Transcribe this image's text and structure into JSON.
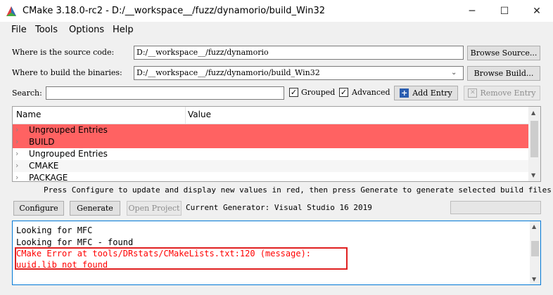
{
  "window": {
    "title": "CMake 3.18.0-rc2 - D:/__workspace__/fuzz/dynamorio/build_Win32",
    "minimize_glyph": "─",
    "maximize_glyph": "☐",
    "close_glyph": "✕"
  },
  "menu": [
    {
      "label": "File"
    },
    {
      "label": "Tools"
    },
    {
      "label": "Options"
    },
    {
      "label": "Help"
    }
  ],
  "source": {
    "label": "Where is the source code:",
    "value": "D:/__workspace__/fuzz/dynamorio",
    "browse_label": "Browse Source..."
  },
  "build": {
    "label": "Where to build the binaries:",
    "value": "D:/__workspace__/fuzz/dynamorio/build_Win32",
    "browse_label": "Browse Build..."
  },
  "search": {
    "label": "Search:",
    "value": ""
  },
  "options": {
    "grouped_label": "Grouped",
    "grouped_checked": true,
    "advanced_label": "Advanced",
    "advanced_checked": true,
    "add_entry_label": "Add Entry",
    "remove_entry_label": "Remove Entry"
  },
  "table": {
    "col_name": "Name",
    "col_value": "Value",
    "rows": [
      {
        "name": "Ungrouped Entries",
        "highlight": true
      },
      {
        "name": "BUILD",
        "highlight": true
      },
      {
        "name": "Ungrouped Entries",
        "highlight": false
      },
      {
        "name": "CMAKE",
        "highlight": false
      },
      {
        "name": "PACKAGE",
        "highlight": false
      }
    ],
    "row_highlight_color": "#ff6262"
  },
  "hint": "Press Configure to update and display new values in red, then press Generate to generate selected build files.",
  "actions": {
    "configure_label": "Configure",
    "generate_label": "Generate",
    "open_project_label": "Open Project",
    "generator_text": "Current Generator: Visual Studio 16 2019"
  },
  "log": {
    "lines": [
      {
        "text": "Looking for MFC",
        "error": false
      },
      {
        "text": "Looking for MFC - found",
        "error": false
      },
      {
        "text": "CMake Error at tools/DRstats/CMakeLists.txt:120 (message):",
        "error": true
      },
      {
        "text": "  uuid.lib not found",
        "error": true
      }
    ],
    "error_color": "#ff0000",
    "highlight_box_color": "#e02020"
  }
}
